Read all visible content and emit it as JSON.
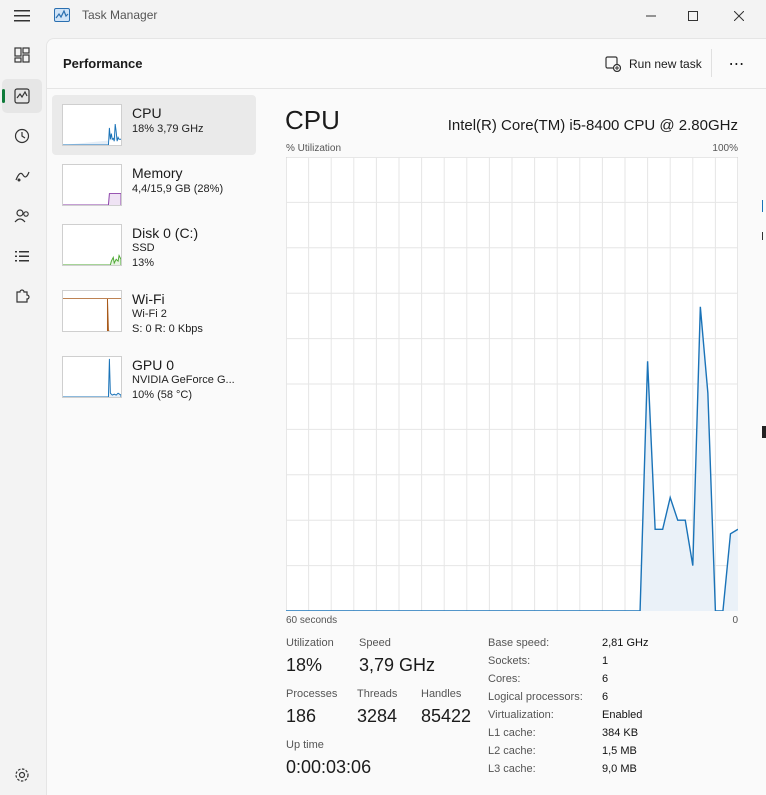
{
  "window": {
    "title": "Task Manager"
  },
  "header": {
    "title": "Performance",
    "run_task_label": "Run new task",
    "more_label": "⋯"
  },
  "perf_items": [
    {
      "name": "CPU",
      "sub1": "18% 3,79 GHz",
      "sub2": "",
      "color": "#1a73b8"
    },
    {
      "name": "Memory",
      "sub1": "4,4/15,9 GB (28%)",
      "sub2": "",
      "color": "#8b3fa8"
    },
    {
      "name": "Disk 0 (C:)",
      "sub1": "SSD",
      "sub2": "13%",
      "color": "#4ca832"
    },
    {
      "name": "Wi-Fi",
      "sub1": "Wi-Fi 2",
      "sub2": "S: 0 R: 0 Kbps",
      "color": "#a85a1a"
    },
    {
      "name": "GPU 0",
      "sub1": "NVIDIA GeForce G...",
      "sub2": "10%  (58 °C)",
      "color": "#1a73b8"
    }
  ],
  "main": {
    "title": "CPU",
    "model": "Intel(R) Core(TM) i5-8400 CPU @ 2.80GHz",
    "y_label": "% Utilization",
    "y_max": "100%",
    "x_left": "60 seconds",
    "x_right": "0"
  },
  "chart_data": {
    "type": "area",
    "title": "CPU",
    "ylabel": "% Utilization",
    "xlabel": "60 seconds",
    "ylim": [
      0,
      100
    ],
    "x": [
      -60,
      -14,
      -13,
      -12,
      -11,
      -10,
      -9,
      -8,
      -7,
      -6,
      -5,
      -4,
      -3,
      -2,
      -1,
      0
    ],
    "values": [
      0,
      0,
      0,
      55,
      18,
      18,
      25,
      20,
      20,
      10,
      67,
      48,
      0,
      0,
      17,
      18
    ],
    "grid": true,
    "color": "#1a73b8"
  },
  "stats": {
    "utilization_label": "Utilization",
    "utilization": "18%",
    "speed_label": "Speed",
    "speed": "3,79 GHz",
    "processes_label": "Processes",
    "processes": "186",
    "threads_label": "Threads",
    "threads": "3284",
    "handles_label": "Handles",
    "handles": "85422",
    "uptime_label": "Up time",
    "uptime": "0:00:03:06"
  },
  "specs": [
    {
      "label": "Base speed:",
      "value": "2,81 GHz"
    },
    {
      "label": "Sockets:",
      "value": "1"
    },
    {
      "label": "Cores:",
      "value": "6"
    },
    {
      "label": "Logical processors:",
      "value": "6"
    },
    {
      "label": "Virtualization:",
      "value": "Enabled"
    },
    {
      "label": "L1 cache:",
      "value": "384 KB"
    },
    {
      "label": "L2 cache:",
      "value": "1,5 MB"
    },
    {
      "label": "L3 cache:",
      "value": "9,0 MB"
    }
  ],
  "colors": {
    "accent": "#1a73b8",
    "nav_indicator": "#0f7b3a"
  }
}
